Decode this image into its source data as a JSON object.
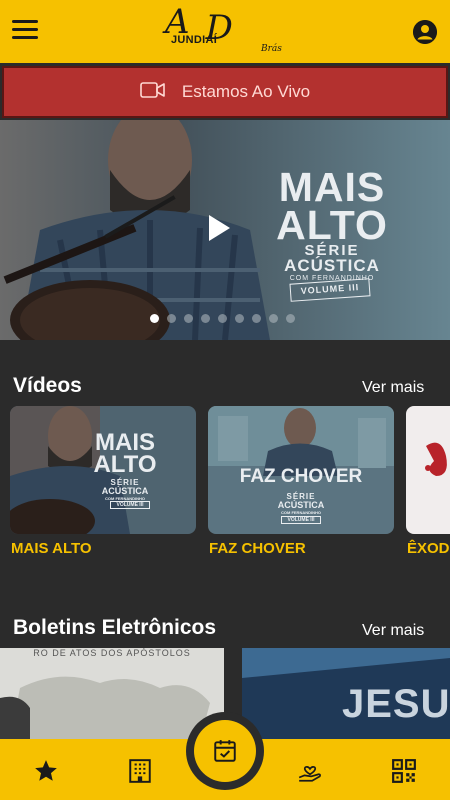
{
  "header": {
    "logo_monogram_a": "A",
    "logo_monogram_d": "D",
    "logo_city": "JUNDIAÍ",
    "logo_suffix": "Brás"
  },
  "live": {
    "label": "Estamos Ao Vivo",
    "icon": "video-camera-icon"
  },
  "hero": {
    "title_line1": "MAIS",
    "title_line2": "ALTO",
    "subtitle_line1": "SÉRIE",
    "subtitle_line2": "ACÚSTICA",
    "subtitle_line3": "COM FERNANDINHO",
    "volume": "VOLUME III",
    "slide_count": 9,
    "active_slide": 1
  },
  "videos": {
    "title": "Vídeos",
    "see_more": "Ver mais",
    "items": [
      {
        "label": "MAIS ALTO",
        "card_title_1": "MAIS",
        "card_title_2": "ALTO",
        "card_sub_1": "SÉRIE",
        "card_sub_2": "ACÚSTICA",
        "card_sub_3": "COM FERNANDINHO",
        "card_vol": "VOLUME III"
      },
      {
        "label": "FAZ CHOVER",
        "card_title_1": "FAZ CHOVER",
        "card_sub_1": "SÉRIE",
        "card_sub_2": "ACÚSTICA",
        "card_sub_3": "COM FERNANDINHO",
        "card_vol": "VOLUME III"
      },
      {
        "label": "ÊXODO"
      }
    ]
  },
  "bulletins": {
    "title": "Boletins Eletrônicos",
    "see_more": "Ver mais",
    "items": [
      {
        "caption": "RO DE ATOS DOS APÓSTOLOS"
      },
      {
        "caption": "JESUS"
      }
    ]
  },
  "bottom_nav": {
    "items": [
      "star-icon",
      "building-icon",
      "calendar-check-icon",
      "hand-heart-icon",
      "qr-code-icon"
    ],
    "accent": "#f6c100"
  },
  "colors": {
    "brand_yellow": "#f6c100",
    "live_red": "#b3312f",
    "background": "#2b2b2b"
  }
}
